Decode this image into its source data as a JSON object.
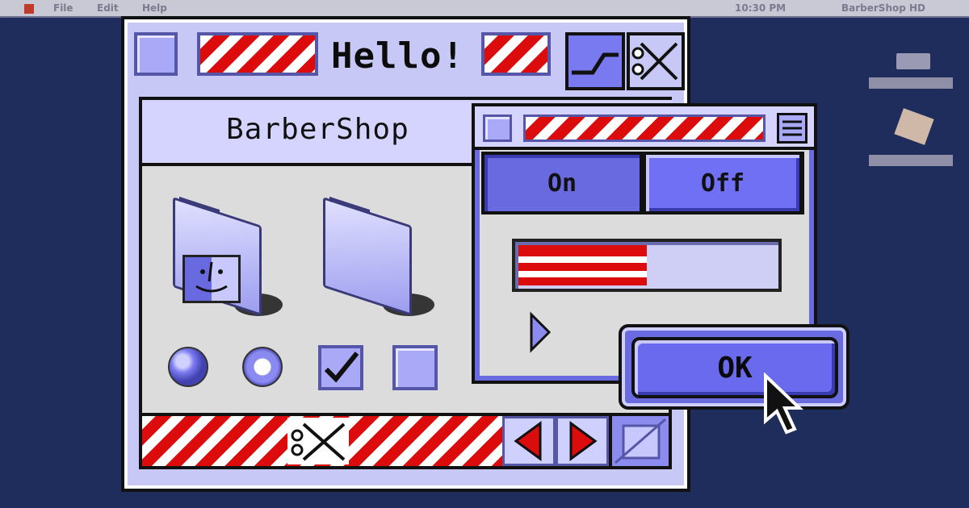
{
  "menubar": {
    "items": [
      "File",
      "Edit",
      "Help"
    ],
    "status_items": [
      "10:30 PM",
      "BarberShop HD"
    ]
  },
  "main_window": {
    "title": "Hello!"
  },
  "path_bar": {
    "label": "BarberShop"
  },
  "sub_window": {
    "segmented": {
      "options": [
        "On",
        "Off"
      ],
      "selected": "Off"
    },
    "progress": 0.5
  },
  "ok_button": {
    "label": "OK"
  },
  "colors": {
    "desktop": "#1e2d5c",
    "accent": "#6a6aee",
    "window": "#c8c8f6",
    "stripe_red": "#dd0c0c"
  },
  "icons": [
    "folder-mac-os-icon",
    "folder-icon",
    "scissors-icon",
    "cursor-arrow-icon",
    "checkbox-checked",
    "checkbox-empty",
    "radio-on",
    "radio-off"
  ]
}
